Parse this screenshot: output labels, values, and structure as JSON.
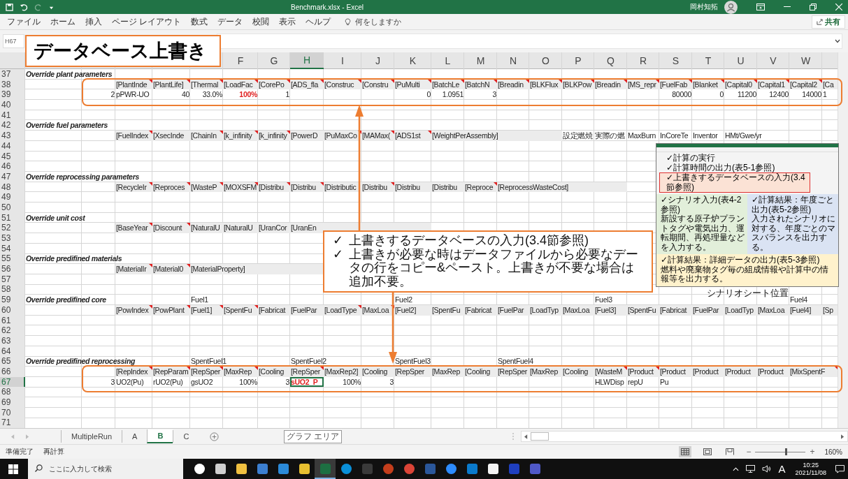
{
  "title_bar": {
    "title": "Benchmark.xlsx - Excel",
    "user": "岡村知拓"
  },
  "menu": {
    "items": [
      "ファイル",
      "ホーム",
      "挿入",
      "ページ レイアウト",
      "数式",
      "データ",
      "校閲",
      "表示",
      "ヘルプ"
    ],
    "tell_me": {
      "placeholder": "何をしますか"
    },
    "share": "共有"
  },
  "name_box": "H67",
  "columns": [
    {
      "letter": "F",
      "selected": false
    },
    {
      "letter": "G",
      "selected": false
    },
    {
      "letter": "H",
      "selected": true
    },
    {
      "letter": "I",
      "selected": false
    },
    {
      "letter": "J",
      "selected": false
    },
    {
      "letter": "K",
      "selected": false
    },
    {
      "letter": "L",
      "selected": false
    },
    {
      "letter": "M",
      "selected": false
    },
    {
      "letter": "N",
      "selected": false
    },
    {
      "letter": "O",
      "selected": false
    },
    {
      "letter": "P",
      "selected": false
    },
    {
      "letter": "Q",
      "selected": false
    },
    {
      "letter": "R",
      "selected": false
    },
    {
      "letter": "S",
      "selected": false
    },
    {
      "letter": "T",
      "selected": false
    },
    {
      "letter": "U",
      "selected": false
    },
    {
      "letter": "V",
      "selected": false
    },
    {
      "letter": "W",
      "selected": false
    }
  ],
  "rows": [
    {
      "num": "37",
      "selected": false,
      "A": {
        "text": "Override plant parameters",
        "kind": "label"
      }
    },
    {
      "num": "38",
      "selected": false,
      "C": {
        "text": "[PlantInde",
        "kind": "header",
        "note": true
      },
      "D": {
        "text": "[PlantLife]",
        "kind": "header",
        "note": true
      },
      "E": {
        "text": "[Thermal",
        "kind": "header",
        "note": true
      },
      "F": {
        "text": "[LoadFac",
        "kind": "header",
        "note": true
      },
      "G": {
        "text": "[CorePo",
        "kind": "header",
        "note": true
      },
      "H": {
        "text": "[ADS_fla",
        "kind": "header",
        "note": true
      },
      "I": {
        "text": "[Construc",
        "kind": "header",
        "note": true
      },
      "J": {
        "text": "[Constru",
        "kind": "header",
        "note": true
      },
      "K": {
        "text": "[PuMulti",
        "kind": "header",
        "note": true
      },
      "L": {
        "text": "[BatchLe",
        "kind": "header",
        "note": true
      },
      "M": {
        "text": "[BatchN",
        "kind": "header",
        "note": true
      },
      "N": {
        "text": "[Breadin",
        "kind": "header",
        "note": true
      },
      "O": {
        "text": "[BLKFlux",
        "kind": "header",
        "note": true
      },
      "P": {
        "text": "[BLKPow",
        "kind": "header",
        "note": true
      },
      "Q": {
        "text": "[Breadin",
        "kind": "header",
        "note": true
      },
      "R": {
        "text": "[MS_repr",
        "kind": "header",
        "note": true
      },
      "S": {
        "text": "[FuelFab",
        "kind": "header",
        "note": true
      },
      "T": {
        "text": "[Blanket",
        "kind": "header",
        "note": true
      },
      "U": {
        "text": "[Capital0",
        "kind": "header",
        "note": true
      },
      "V": {
        "text": "[Capital1",
        "kind": "header",
        "note": true
      },
      "W": {
        "text": "[Capital2",
        "kind": "header",
        "note": true
      },
      "X": {
        "text": "[Ca",
        "kind": "header",
        "note": false
      }
    },
    {
      "num": "39",
      "selected": false,
      "B": {
        "text": "2",
        "kind": "number"
      },
      "C": {
        "text": "pPWR-UO",
        "kind": "text"
      },
      "D": {
        "text": "40",
        "kind": "number"
      },
      "E": {
        "text": "33.0%",
        "kind": "number"
      },
      "F": {
        "text": "100%",
        "kind": "warning-number"
      },
      "G": {
        "text": "1",
        "kind": "number"
      },
      "K": {
        "text": "0",
        "kind": "number"
      },
      "L": {
        "text": "1.0951",
        "kind": "number"
      },
      "M": {
        "text": "3",
        "kind": "number"
      },
      "S": {
        "text": "80000",
        "kind": "number"
      },
      "T": {
        "text": "0",
        "kind": "number"
      },
      "U": {
        "text": "11200",
        "kind": "number"
      },
      "V": {
        "text": "12400",
        "kind": "number"
      },
      "W": {
        "text": "14000",
        "kind": "number"
      },
      "X": {
        "text": "1",
        "kind": "text"
      }
    },
    {
      "num": "40",
      "selected": false
    },
    {
      "num": "41",
      "selected": false
    },
    {
      "num": "42",
      "selected": false,
      "A": {
        "text": "Override fuel parameters",
        "kind": "label"
      }
    },
    {
      "num": "43",
      "selected": false,
      "C": {
        "text": "[FuelIndex",
        "kind": "header",
        "note": true
      },
      "D": {
        "text": "[XsecInde",
        "kind": "header",
        "note": false
      },
      "E": {
        "text": "[ChainIn",
        "kind": "header",
        "note": true
      },
      "F": {
        "text": "[k_infinity",
        "kind": "header",
        "note": true
      },
      "G": {
        "text": "[k_infinity",
        "kind": "header",
        "note": true
      },
      "H": {
        "text": "[PowerD",
        "kind": "header",
        "note": false
      },
      "I": {
        "text": "[PuMaxCo",
        "kind": "header",
        "note": true
      },
      "J": {
        "text": "[MAMax(",
        "kind": "header",
        "note": true
      },
      "K": {
        "text": "[ADS1st",
        "kind": "header",
        "note": true
      },
      "L": {
        "text": "[WeightPerAssembly]",
        "kind": "header",
        "note": false
      },
      "P": {
        "text": "設定燃焼",
        "kind": "text"
      },
      "Q": {
        "text": "実際の燃",
        "kind": "text"
      },
      "R": {
        "text": "MaxBurn",
        "kind": "text"
      },
      "S": {
        "text": "InCoreTe",
        "kind": "text"
      },
      "T": {
        "text": "Inventor",
        "kind": "text"
      },
      "U": {
        "text": "HMt/Gwe/yr",
        "kind": "text"
      }
    },
    {
      "num": "44",
      "selected": false
    },
    {
      "num": "45",
      "selected": false
    },
    {
      "num": "46",
      "selected": false
    },
    {
      "num": "47",
      "selected": false,
      "A": {
        "text": "Override reprocessing parameters",
        "kind": "label"
      }
    },
    {
      "num": "48",
      "selected": false,
      "C": {
        "text": "[RecycleIr",
        "kind": "header",
        "note": true
      },
      "D": {
        "text": "[Reproces",
        "kind": "header",
        "note": true
      },
      "E": {
        "text": "[WasteP",
        "kind": "header",
        "note": true
      },
      "F": {
        "text": "[MOXSFM",
        "kind": "header",
        "note": true
      },
      "G": {
        "text": "[Distribu",
        "kind": "header",
        "note": true
      },
      "H": {
        "text": "[Distribu",
        "kind": "header",
        "note": true
      },
      "I": {
        "text": "[Distributic",
        "kind": "header",
        "note": false
      },
      "J": {
        "text": "[Distribu",
        "kind": "header",
        "note": true
      },
      "K": {
        "text": "[Distribu",
        "kind": "header",
        "note": false
      },
      "L": {
        "text": "[Distribu",
        "kind": "header",
        "note": false
      },
      "M": {
        "text": "[Reproce",
        "kind": "header",
        "note": true
      },
      "N": {
        "text": "[ReprocessWasteCost]",
        "kind": "header",
        "note": false
      }
    },
    {
      "num": "49",
      "selected": false
    },
    {
      "num": "50",
      "selected": false
    },
    {
      "num": "51",
      "selected": false,
      "A": {
        "text": "Override unit cost",
        "kind": "label"
      }
    },
    {
      "num": "52",
      "selected": false,
      "C": {
        "text": "[BaseYear",
        "kind": "header",
        "note": true
      },
      "D": {
        "text": "[Discount",
        "kind": "header",
        "note": true
      },
      "E": {
        "text": "[NaturalU",
        "kind": "header",
        "note": false
      },
      "F": {
        "text": "[NaturalU",
        "kind": "header",
        "note": false
      },
      "G": {
        "text": "[UranCor",
        "kind": "header",
        "note": false
      },
      "H": {
        "text": "[UranEn",
        "kind": "header",
        "note": false
      }
    },
    {
      "num": "53",
      "selected": false
    },
    {
      "num": "54",
      "selected": false
    },
    {
      "num": "55",
      "selected": false,
      "A": {
        "text": "Override predifined materials",
        "kind": "label"
      }
    },
    {
      "num": "56",
      "selected": false,
      "C": {
        "text": "[MaterialIr",
        "kind": "header",
        "note": true
      },
      "D": {
        "text": "[Material0",
        "kind": "header",
        "note": true
      },
      "E": {
        "text": "[MaterialProperty]",
        "kind": "header",
        "note": false
      }
    },
    {
      "num": "57",
      "selected": false
    },
    {
      "num": "58",
      "selected": false
    },
    {
      "num": "59",
      "selected": false,
      "A": {
        "text": "Override predifined core",
        "kind": "label"
      },
      "E": {
        "text": "Fuel1",
        "kind": "text"
      },
      "K": {
        "text": "Fuel2",
        "kind": "text"
      },
      "Q": {
        "text": "Fuel3",
        "kind": "text"
      },
      "W": {
        "text": "Fuel4",
        "kind": "text"
      }
    },
    {
      "num": "60",
      "selected": false,
      "C": {
        "text": "[PowIndex",
        "kind": "header",
        "note": true
      },
      "D": {
        "text": "[PowPlant",
        "kind": "header",
        "note": true
      },
      "E": {
        "text": "[Fuel1]",
        "kind": "header",
        "note": true
      },
      "F": {
        "text": "[SpentFu",
        "kind": "header",
        "note": true
      },
      "G": {
        "text": "[Fabricat",
        "kind": "header",
        "note": false
      },
      "H": {
        "text": "[FuelPar",
        "kind": "header",
        "note": false
      },
      "I": {
        "text": "[LoadType",
        "kind": "header",
        "note": true
      },
      "J": {
        "text": "[MaxLoa",
        "kind": "header",
        "note": true
      },
      "K": {
        "text": "[Fuel2]",
        "kind": "header",
        "note": false
      },
      "L": {
        "text": "[SpentFu",
        "kind": "header",
        "note": false
      },
      "M": {
        "text": "[Fabricat",
        "kind": "header",
        "note": false
      },
      "N": {
        "text": "[FuelPar",
        "kind": "header",
        "note": false
      },
      "O": {
        "text": "[LoadTyp",
        "kind": "header",
        "note": false
      },
      "P": {
        "text": "[MaxLoa",
        "kind": "header",
        "note": false
      },
      "Q": {
        "text": "[Fuel3]",
        "kind": "header",
        "note": false
      },
      "R": {
        "text": "[SpentFu",
        "kind": "header",
        "note": false
      },
      "S": {
        "text": "[Fabricat",
        "kind": "header",
        "note": false
      },
      "T": {
        "text": "[FuelPar",
        "kind": "header",
        "note": false
      },
      "U": {
        "text": "[LoadTyp",
        "kind": "header",
        "note": false
      },
      "V": {
        "text": "[MaxLoa",
        "kind": "header",
        "note": false
      },
      "W": {
        "text": "[Fuel4]",
        "kind": "header",
        "note": false
      },
      "X": {
        "text": "[Sp",
        "kind": "header",
        "note": false
      }
    },
    {
      "num": "61",
      "selected": false
    },
    {
      "num": "62",
      "selected": false
    },
    {
      "num": "63",
      "selected": false
    },
    {
      "num": "64",
      "selected": false
    },
    {
      "num": "65",
      "selected": false,
      "A": {
        "text": "Override predifined reprocessing",
        "kind": "label"
      },
      "E": {
        "text": "SpentFuel1",
        "kind": "text"
      },
      "H": {
        "text": "SpentFuel2",
        "kind": "text"
      },
      "K": {
        "text": "SpentFuel3",
        "kind": "text"
      },
      "N": {
        "text": "SpentFuel4",
        "kind": "text"
      }
    },
    {
      "num": "66",
      "selected": false,
      "C": {
        "text": "[RepIndex",
        "kind": "header",
        "note": true
      },
      "D": {
        "text": "[RepParam",
        "kind": "header",
        "note": true
      },
      "E": {
        "text": "[RepSper",
        "kind": "header",
        "note": true
      },
      "F": {
        "text": "[MaxRep",
        "kind": "header",
        "note": true
      },
      "G": {
        "text": "[Cooling",
        "kind": "header",
        "note": false
      },
      "H": {
        "text": "[RepSper",
        "kind": "header",
        "note": true
      },
      "I": {
        "text": "[MaxRep2]",
        "kind": "header",
        "note": false
      },
      "J": {
        "text": "[Cooling",
        "kind": "header",
        "note": false
      },
      "K": {
        "text": "[RepSper",
        "kind": "header",
        "note": false
      },
      "L": {
        "text": "[MaxRep",
        "kind": "header",
        "note": false
      },
      "M": {
        "text": "[Cooling",
        "kind": "header",
        "note": false
      },
      "N": {
        "text": "[RepSper",
        "kind": "header",
        "note": false
      },
      "O": {
        "text": "[MaxRep",
        "kind": "header",
        "note": false
      },
      "P": {
        "text": "[Cooling",
        "kind": "header",
        "note": false
      },
      "Q": {
        "text": "[WasteM",
        "kind": "header",
        "note": true
      },
      "R": {
        "text": "[Product",
        "kind": "header",
        "note": true
      },
      "S": {
        "text": "[Product",
        "kind": "header",
        "note": false
      },
      "T": {
        "text": "[Product",
        "kind": "header",
        "note": false
      },
      "U": {
        "text": "[Product",
        "kind": "header",
        "note": false
      },
      "V": {
        "text": "[Product",
        "kind": "header",
        "note": false
      },
      "W": {
        "text": "[MixSpentF",
        "kind": "header",
        "note": true
      }
    },
    {
      "num": "67",
      "selected": true,
      "B": {
        "text": "3",
        "kind": "number"
      },
      "C": {
        "text": "UO2(Pu)",
        "kind": "text"
      },
      "D": {
        "text": "rUO2(Pu)",
        "kind": "text"
      },
      "E": {
        "text": "gsUO2",
        "kind": "text"
      },
      "F": {
        "text": "100%",
        "kind": "number"
      },
      "G": {
        "text": "3",
        "kind": "number"
      },
      "H": {
        "text": "sUO2_P",
        "kind": "warning-text"
      },
      "I": {
        "text": "100%",
        "kind": "number"
      },
      "J": {
        "text": "3",
        "kind": "number"
      },
      "Q": {
        "text": "HLWDisp",
        "kind": "text"
      },
      "R": {
        "text": "repU",
        "kind": "text"
      },
      "S": {
        "text": "Pu",
        "kind": "text"
      }
    },
    {
      "num": "68",
      "selected": false
    },
    {
      "num": "69",
      "selected": false
    },
    {
      "num": "70",
      "selected": false
    },
    {
      "num": "71",
      "selected": false
    }
  ],
  "title_callout": "データベース上書き",
  "note_callout": [
    {
      "mark": "✓",
      "text": "上書きするデータベースの入力(3.4節参照)"
    },
    {
      "mark": "✓",
      "text": "上書きが必要な時はデータファイルから必要なデータの行をコピー&ペースト。上書きが不要な場合は追加不要。"
    }
  ],
  "inset": {
    "items": [
      {
        "text": "✓計算の実行",
        "highlighted": false
      },
      {
        "text": "✓計算時間の出力(表5-1参照)",
        "highlighted": false
      },
      {
        "text": "✓上書きするデータベースの入力(3.4節参照)",
        "highlighted": true
      }
    ],
    "panels": [
      {
        "title": "✓シナリオ入力(表4-2参照)",
        "body": "新設する原子炉プラントタグや電気出力、運転期間、再処理量などを入力する。",
        "color": "#e2efda"
      },
      {
        "title": "✓計算結果：年度ごと出力(表5-2参照)",
        "body": "入力されたシナリオに対する、年度ごとのマスバランスを出力する。",
        "color": "#dae3f3"
      },
      {
        "title": "✓計算結果：詳細データの出力(表5-3参照)",
        "body": "燃料や廃棄物タグ毎の組成情報や計算中の情報等を出力する。",
        "color": "#fff2cc"
      }
    ],
    "caption": "シナリオシート位置"
  },
  "sheet_tabs": [
    {
      "label": "MultipleRun",
      "selected": false
    },
    {
      "label": "A",
      "selected": false
    },
    {
      "label": "B",
      "selected": true
    },
    {
      "label": "C",
      "selected": false
    }
  ],
  "tooltip": "グラフ エリア",
  "status_bar": {
    "left": [
      "準備完了",
      "再計算"
    ],
    "views": [
      {
        "kind": "normal",
        "selected": true
      },
      {
        "kind": "page-layout",
        "selected": false
      },
      {
        "kind": "page-break",
        "selected": false
      }
    ],
    "zoom_out": "−",
    "zoom_in": "+",
    "zoom": {
      "level": 0.6,
      "reading": "160%"
    }
  },
  "taskbar": {
    "search": {
      "placeholder": "ここに入力して検索"
    },
    "apps": [
      {
        "kind": "circle",
        "color": "#ffffff",
        "selected": false
      },
      {
        "kind": "square",
        "color": "#d0d0d0",
        "selected": false
      },
      {
        "kind": "square",
        "color": "#f0c040",
        "selected": false
      },
      {
        "kind": "square",
        "color": "#3c7fd0",
        "selected": false
      },
      {
        "kind": "square",
        "color": "#2b8ad8",
        "selected": false
      },
      {
        "kind": "square",
        "color": "#e8c030",
        "selected": false
      },
      {
        "kind": "square",
        "color": "#1d6f42",
        "selected": true
      },
      {
        "kind": "circle",
        "color": "#0a8fd8",
        "selected": false
      },
      {
        "kind": "square",
        "color": "#3a3a3a",
        "selected": false
      },
      {
        "kind": "circle",
        "color": "#c43e1c",
        "selected": false
      },
      {
        "kind": "circle",
        "color": "#db4437",
        "selected": false
      },
      {
        "kind": "square",
        "color": "#2b579a",
        "selected": false
      },
      {
        "kind": "circle",
        "color": "#2d8cff",
        "selected": false
      },
      {
        "kind": "square",
        "color": "#0a7acc",
        "selected": false
      },
      {
        "kind": "square",
        "color": "#f4f4f4",
        "selected": false
      },
      {
        "kind": "square",
        "color": "#1f3fbf",
        "selected": false
      },
      {
        "kind": "square",
        "color": "#5059c9",
        "selected": false
      }
    ],
    "ime": "A",
    "time": "10:25",
    "date": "2021/11/08"
  }
}
